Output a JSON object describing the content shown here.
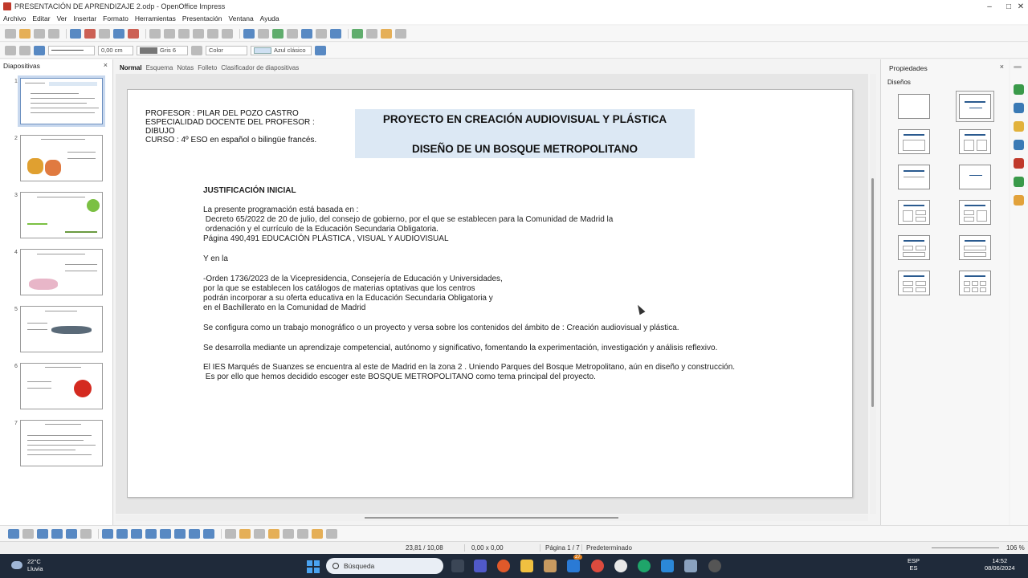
{
  "window": {
    "title": "PRESENTACIÓN DE APRENDIZAJE 2.odp - OpenOffice Impress",
    "minimize": "–",
    "maximize": "□",
    "close": "✕"
  },
  "menu": [
    "Archivo",
    "Editar",
    "Ver",
    "Insertar",
    "Formato",
    "Herramientas",
    "Presentación",
    "Ventana",
    "Ayuda"
  ],
  "line_toolbar": {
    "width_value": "0,00 cm",
    "line_color": "Gris 6",
    "area_style": "Color",
    "area_color": "Azul clásico"
  },
  "slide_panel": {
    "title": "Diapositivas",
    "close": "×",
    "slides": [
      {
        "number": "1",
        "selected": true
      },
      {
        "number": "2",
        "selected": false
      },
      {
        "number": "3",
        "selected": false
      },
      {
        "number": "4",
        "selected": false
      },
      {
        "number": "5",
        "selected": false
      },
      {
        "number": "6",
        "selected": false
      },
      {
        "number": "7",
        "selected": false
      }
    ]
  },
  "view_tabs": [
    "Normal",
    "Esquema",
    "Notas",
    "Folleto",
    "Clasificador de diapositivas"
  ],
  "slide": {
    "teacher_info": "PROFESOR : PILAR DEL POZO CASTRO\nESPECIALIDAD DOCENTE DEL PROFESOR :\nDIBUJO\nCURSO : 4º ESO en español o bilingüe francés.",
    "title_line1": "PROYECTO EN CREACIÓN AUDIOVISUAL Y PLÁSTICA",
    "title_line2": "DISEÑO DE UN BOSQUE METROPOLITANO",
    "heading": "JUSTIFICACIÓN INICIAL",
    "p1": "La presente programación está basada en :\n Decreto 65/2022 de 20 de julio, del consejo de gobierno, por el que se establecen para la Comunidad de Madrid la\n ordenación y el currículo de la Educación Secundaria Obligatoria.\nPágina 490,491 EDUCACIÓN PLÁSTICA , VISUAL Y AUDIOVISUAL",
    "p2": "Y en la",
    "p3": "-Orden 1736/2023 de la Vicepresidencia, Consejería de Educación y Universidades,\npor la que se establecen los catálogos de materias optativas que los centros\npodrán incorporar a su oferta educativa en la Educación Secundaria Obligatoria y\nen el Bachillerato en la Comunidad de Madrid",
    "p4": "Se configura como un trabajo monográfico o un proyecto y versa sobre los contenidos del ámbito de : Creación audiovisual y plástica.",
    "p5": "Se desarrolla mediante un aprendizaje competencial, autónomo y significativo, fomentando la experimentación, investigación y análisis reflexivo.",
    "p6": "El IES Marqués de Suanzes se encuentra al este de Madrid en la zona 2 . Uniendo Parques del Bosque Metropolitano, aún en diseño y construcción.\n Es por ello que hemos decidido escoger este BOSQUE METROPOLITANO como tema principal del proyecto."
  },
  "properties": {
    "title": "Propiedades",
    "close": "×",
    "section": "Diseños"
  },
  "status": {
    "position": "23,81 / 10,08",
    "size": "0,00 x 0,00",
    "page": "Página 1 / 7",
    "master": "Predeterminado",
    "zoom": "106 %"
  },
  "taskbar": {
    "temperature": "22°C",
    "weather": "Lluvia",
    "search_placeholder": "Búsqueda",
    "lang_top": "ESP",
    "lang_bottom": "ES",
    "time": "14:52",
    "date": "08/06/2024",
    "notification_count": "27"
  }
}
